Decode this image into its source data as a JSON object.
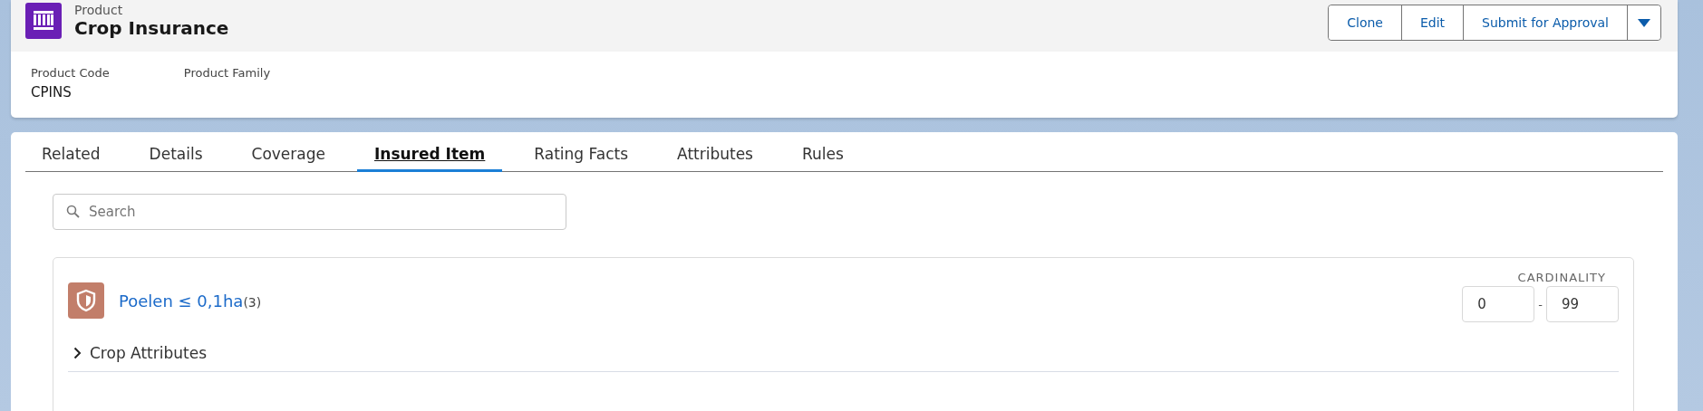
{
  "record": {
    "object_label": "Product",
    "title": "Crop Insurance"
  },
  "actions": [
    {
      "label": "Clone"
    },
    {
      "label": "Edit"
    },
    {
      "label": "Submit for Approval"
    }
  ],
  "fields": [
    {
      "label": "Product Code",
      "value": "CPINS"
    },
    {
      "label": "Product Family"
    }
  ],
  "tabs": [
    {
      "label": "Related",
      "selected": false
    },
    {
      "label": "Details",
      "selected": false
    },
    {
      "label": "Coverage",
      "selected": false
    },
    {
      "label": "Insured Item",
      "selected": true
    },
    {
      "label": "Rating Facts",
      "selected": false
    },
    {
      "label": "Attributes",
      "selected": false
    },
    {
      "label": "Rules",
      "selected": false
    }
  ],
  "search": {
    "placeholder": "Search"
  },
  "item": {
    "name": "Poelen ≤ 0,1ha",
    "count": "(3)",
    "cardinality_label": "CARDINALITY",
    "min": "0",
    "separator": "-",
    "max": "99",
    "sections": [
      {
        "label": "Crop Attributes",
        "expanded": false
      }
    ]
  }
}
